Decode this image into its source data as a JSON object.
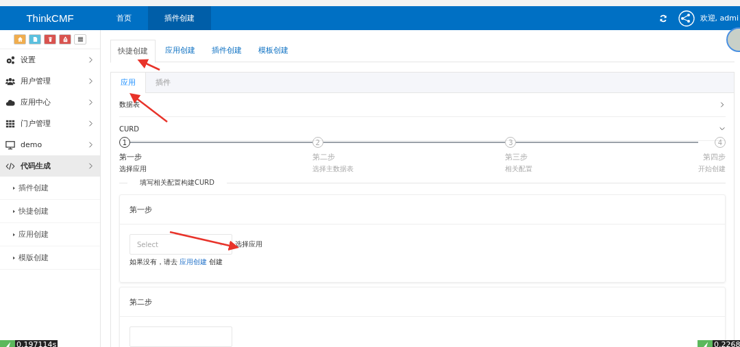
{
  "header": {
    "logo": "ThinkCMF",
    "nav": [
      {
        "label": "首页",
        "selected": false
      },
      {
        "label": "插件创建",
        "selected": true
      }
    ],
    "welcome": "欢迎, admi"
  },
  "sidebar": {
    "toolbar": [
      {
        "kind": "home",
        "color": "#f0ad4e"
      },
      {
        "kind": "file",
        "color": "#5bc0de"
      },
      {
        "kind": "trash",
        "color": "#d9534f"
      },
      {
        "kind": "recycle",
        "color": "#d9534f"
      },
      {
        "kind": "list",
        "color": "#ffffff"
      }
    ],
    "items": [
      {
        "kind": "gears",
        "label": "设置",
        "selected": false
      },
      {
        "kind": "users",
        "label": "用户管理",
        "selected": false
      },
      {
        "kind": "cloud",
        "label": "应用中心",
        "selected": false
      },
      {
        "kind": "grid",
        "label": "门户管理",
        "selected": false
      },
      {
        "kind": "monitor",
        "label": "demo",
        "selected": false
      },
      {
        "kind": "code",
        "label": "代码生成",
        "selected": true,
        "children": [
          {
            "label": "插件创建"
          },
          {
            "label": "快捷创建"
          },
          {
            "label": "应用创建"
          },
          {
            "label": "模版创建"
          }
        ]
      }
    ]
  },
  "tabs": [
    {
      "label": "快捷创建",
      "selected": true
    },
    {
      "label": "应用创建",
      "selected": false
    },
    {
      "label": "插件创建",
      "selected": false
    },
    {
      "label": "模板创建",
      "selected": false
    }
  ],
  "subtabs": [
    {
      "label": "应用",
      "selected": true
    },
    {
      "label": "插件",
      "selected": false
    }
  ],
  "panels": [
    {
      "title": "数据表",
      "expanded": false
    },
    {
      "title": "CURD",
      "expanded": true
    }
  ],
  "steps": [
    {
      "number": "1",
      "title": "第一步",
      "description": "选择应用",
      "selected": true
    },
    {
      "number": "2",
      "title": "第二步",
      "description": "选择主数据表",
      "selected": false
    },
    {
      "number": "3",
      "title": "第三步",
      "description": "相关配置",
      "selected": false
    },
    {
      "number": "4",
      "title": "第四步",
      "description": "开始创建",
      "selected": false
    }
  ],
  "divider_text": "填写相关配置构建CURD",
  "cards": [
    {
      "title": "第一步",
      "placeholder": "Select",
      "label": "选择应用",
      "hint_before": "如果没有，请去",
      "hint_link": "应用创建",
      "hint_after": "创建"
    },
    {
      "title": "第二步"
    }
  ],
  "timers": [
    "0.197114s",
    "0.2268"
  ]
}
